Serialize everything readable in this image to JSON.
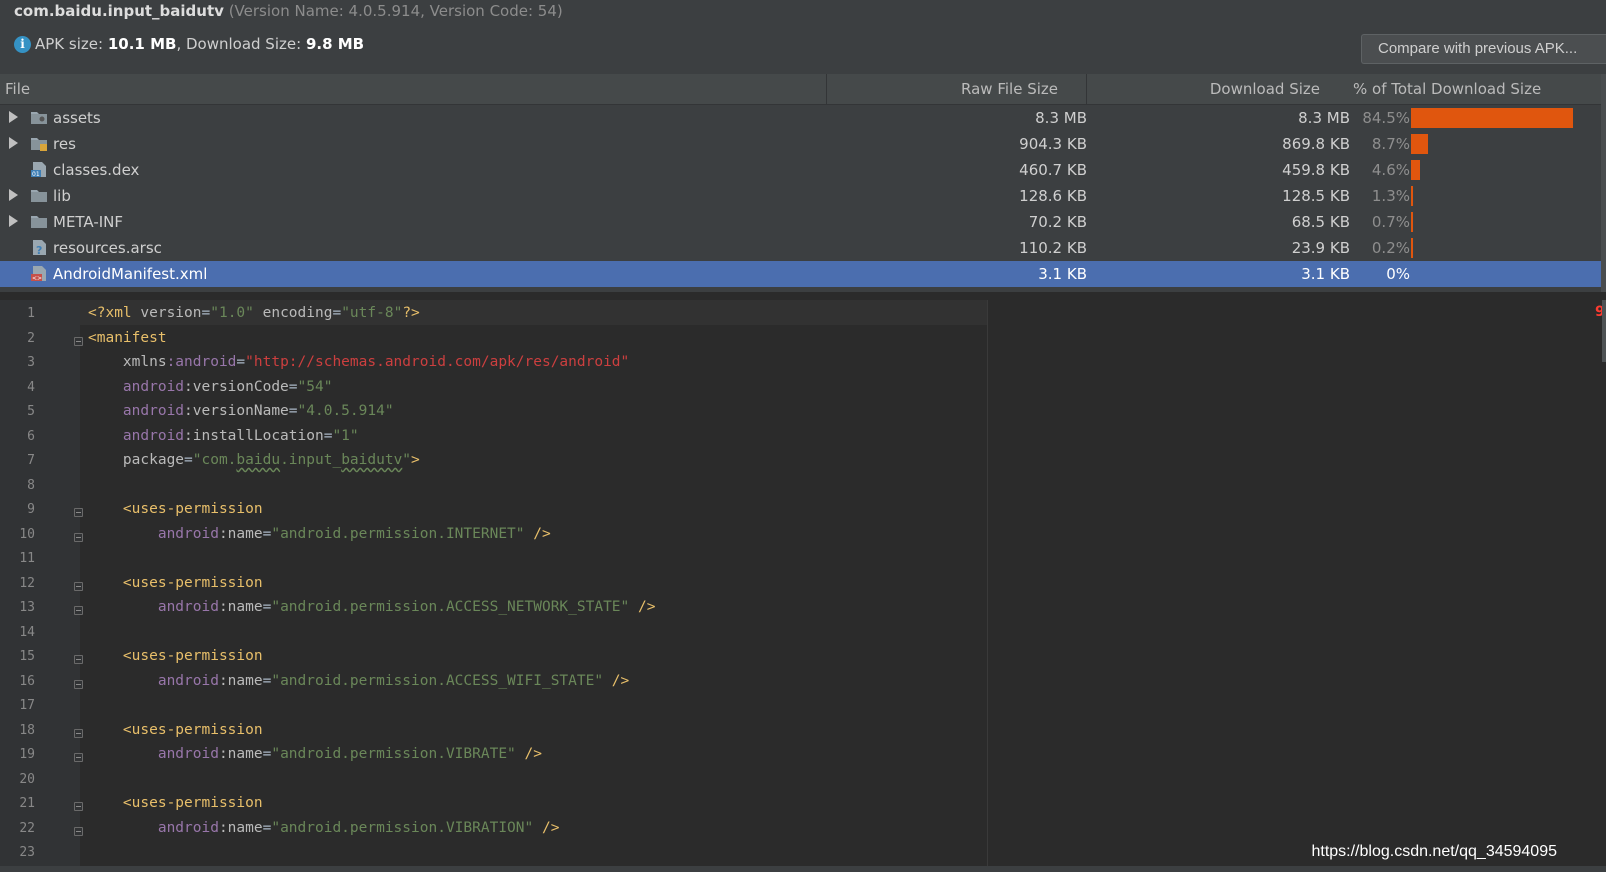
{
  "header": {
    "package": "com.baidu.input_baidutv",
    "version_info": "(Version Name: 4.0.5.914, Version Code: 54)",
    "info_icon": "info-icon",
    "apk_size_label": "APK size:",
    "apk_size_value": "10.1 MB",
    "download_size_label": ", Download Size:",
    "download_size_value": "9.8 MB",
    "compare_button": "Compare with previous APK..."
  },
  "files": {
    "columns": {
      "file": "File",
      "raw": "Raw File Size",
      "download": "Download Size",
      "pct": "% of Total Download Size"
    },
    "rows": [
      {
        "name": "assets",
        "raw": "8.3 MB",
        "download": "8.3 MB",
        "pct": "84.5%",
        "share": 84.5,
        "expandable": true,
        "icon": "folder-assets-icon"
      },
      {
        "name": "res",
        "raw": "904.3 KB",
        "download": "869.8 KB",
        "pct": "8.7%",
        "share": 8.7,
        "expandable": true,
        "icon": "folder-res-icon"
      },
      {
        "name": "classes.dex",
        "raw": "460.7 KB",
        "download": "459.8 KB",
        "pct": "4.6%",
        "share": 4.6,
        "expandable": false,
        "icon": "dex-file-icon"
      },
      {
        "name": "lib",
        "raw": "128.6 KB",
        "download": "128.5 KB",
        "pct": "1.3%",
        "share": 1.3,
        "expandable": true,
        "icon": "folder-icon"
      },
      {
        "name": "META-INF",
        "raw": "70.2 KB",
        "download": "68.5 KB",
        "pct": "0.7%",
        "share": 0.7,
        "expandable": true,
        "icon": "folder-icon"
      },
      {
        "name": "resources.arsc",
        "raw": "110.2 KB",
        "download": "23.9 KB",
        "pct": "0.2%",
        "share": 0.2,
        "expandable": false,
        "icon": "arsc-file-icon"
      },
      {
        "name": "AndroidManifest.xml",
        "raw": "3.1 KB",
        "download": "3.1 KB",
        "pct": "0%",
        "share": 0,
        "expandable": false,
        "icon": "xml-file-icon",
        "selected": true
      }
    ]
  },
  "editor": {
    "line_numbers": [
      "1",
      "2",
      "3",
      "4",
      "5",
      "6",
      "7",
      "8",
      "9",
      "10",
      "11",
      "12",
      "13",
      "14",
      "15",
      "16",
      "17",
      "18",
      "19",
      "20",
      "21",
      "22",
      "23"
    ],
    "lines": [
      [
        {
          "t": "<?xml ",
          "c": "tag"
        },
        {
          "t": "version",
          "c": "attr"
        },
        {
          "t": "=",
          "c": ""
        },
        {
          "t": "\"1.0\"",
          "c": "val"
        },
        {
          "t": " encoding",
          "c": "attr"
        },
        {
          "t": "=",
          "c": ""
        },
        {
          "t": "\"utf-8\"",
          "c": "val"
        },
        {
          "t": "?>",
          "c": "tag"
        }
      ],
      [
        {
          "t": "<manifest",
          "c": "tag"
        }
      ],
      [
        {
          "t": "    xmlns",
          "c": "attr"
        },
        {
          "t": ":android",
          "c": "ns"
        },
        {
          "t": "=",
          "c": ""
        },
        {
          "t": "\"http://schemas.android.com/apk/res/android\"",
          "c": "url"
        }
      ],
      [
        {
          "t": "    android",
          "c": "ns"
        },
        {
          "t": ":versionCode",
          "c": "attr"
        },
        {
          "t": "=",
          "c": ""
        },
        {
          "t": "\"54\"",
          "c": "val"
        }
      ],
      [
        {
          "t": "    android",
          "c": "ns"
        },
        {
          "t": ":versionName",
          "c": "attr"
        },
        {
          "t": "=",
          "c": ""
        },
        {
          "t": "\"4.0.5.914\"",
          "c": "val"
        }
      ],
      [
        {
          "t": "    android",
          "c": "ns"
        },
        {
          "t": ":installLocation",
          "c": "attr"
        },
        {
          "t": "=",
          "c": ""
        },
        {
          "t": "\"1\"",
          "c": "val"
        }
      ],
      [
        {
          "t": "    package",
          "c": "attr"
        },
        {
          "t": "=",
          "c": ""
        },
        {
          "t": "\"com.",
          "c": "val"
        },
        {
          "t": "baidu",
          "c": "val wavy"
        },
        {
          "t": ".input_",
          "c": "val"
        },
        {
          "t": "baidutv",
          "c": "val wavy"
        },
        {
          "t": "\"",
          "c": "val"
        },
        {
          "t": ">",
          "c": "tag"
        }
      ],
      [],
      [
        {
          "t": "    <uses-permission",
          "c": "tag"
        }
      ],
      [
        {
          "t": "        android",
          "c": "ns"
        },
        {
          "t": ":name",
          "c": "attr"
        },
        {
          "t": "=",
          "c": ""
        },
        {
          "t": "\"android.permission.INTERNET\"",
          "c": "val"
        },
        {
          "t": " />",
          "c": "tag"
        }
      ],
      [],
      [
        {
          "t": "    <uses-permission",
          "c": "tag"
        }
      ],
      [
        {
          "t": "        android",
          "c": "ns"
        },
        {
          "t": ":name",
          "c": "attr"
        },
        {
          "t": "=",
          "c": ""
        },
        {
          "t": "\"android.permission.ACCESS_NETWORK_STATE\"",
          "c": "val"
        },
        {
          "t": " />",
          "c": "tag"
        }
      ],
      [],
      [
        {
          "t": "    <uses-permission",
          "c": "tag"
        }
      ],
      [
        {
          "t": "        android",
          "c": "ns"
        },
        {
          "t": ":name",
          "c": "attr"
        },
        {
          "t": "=",
          "c": ""
        },
        {
          "t": "\"android.permission.ACCESS_WIFI_STATE\"",
          "c": "val"
        },
        {
          "t": " />",
          "c": "tag"
        }
      ],
      [],
      [
        {
          "t": "    <uses-permission",
          "c": "tag"
        }
      ],
      [
        {
          "t": "        android",
          "c": "ns"
        },
        {
          "t": ":name",
          "c": "attr"
        },
        {
          "t": "=",
          "c": ""
        },
        {
          "t": "\"android.permission.VIBRATE\"",
          "c": "val"
        },
        {
          "t": " />",
          "c": "tag"
        }
      ],
      [],
      [
        {
          "t": "    <uses-permission",
          "c": "tag"
        }
      ],
      [
        {
          "t": "        android",
          "c": "ns"
        },
        {
          "t": ":name",
          "c": "attr"
        },
        {
          "t": "=",
          "c": ""
        },
        {
          "t": "\"android.permission.VIBRATION\"",
          "c": "val"
        },
        {
          "t": " />",
          "c": "tag"
        }
      ],
      []
    ],
    "fold_lines": [
      2,
      9,
      10,
      12,
      13,
      15,
      16,
      18,
      19,
      21,
      22
    ],
    "error_marker": "9"
  },
  "watermark": "https://blog.csdn.net/qq_34594095",
  "colors": {
    "bar": "#e0560e",
    "selection": "#4b6eaf",
    "panel": "#3c3f41",
    "editor_bg": "#2b2b2b"
  }
}
